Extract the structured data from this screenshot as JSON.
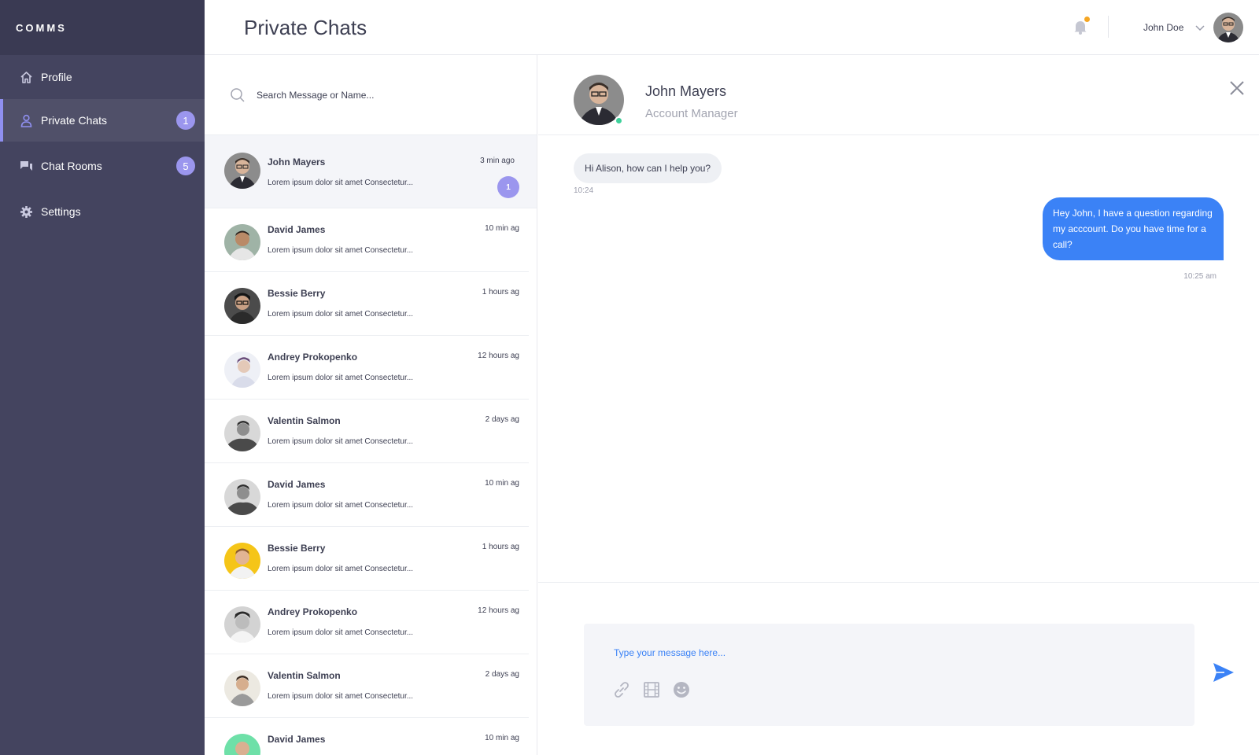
{
  "brand": {
    "name": "COMMS"
  },
  "nav": [
    {
      "label": "Profile",
      "icon": "home-icon",
      "badge": ""
    },
    {
      "label": "Private Chats",
      "icon": "user-icon",
      "badge": "1"
    },
    {
      "label": "Chat Rooms",
      "icon": "chat-rooms-icon",
      "badge": "5"
    },
    {
      "label": "Settings",
      "icon": "gear-icon",
      "badge": ""
    }
  ],
  "header": {
    "title": "Private Chats",
    "user_name": "John Doe",
    "notification_dot_color": "#f5a623"
  },
  "search": {
    "placeholder": "Search Message or Name..."
  },
  "chats": [
    {
      "name": "John Mayers",
      "preview": "Lorem ipsum dolor sit amet Consectetur...",
      "time": "3 min ago",
      "unread": "1"
    },
    {
      "name": "David James",
      "preview": "Lorem ipsum dolor sit amet Consectetur...",
      "time": "10 min ag"
    },
    {
      "name": "Bessie Berry",
      "preview": "Lorem ipsum dolor sit amet Consectetur...",
      "time": "1 hours ag"
    },
    {
      "name": "Andrey Prokopenko",
      "preview": "Lorem ipsum dolor sit amet Consectetur...",
      "time": "12 hours ag"
    },
    {
      "name": "Valentin Salmon",
      "preview": "Lorem ipsum dolor sit amet Consectetur...",
      "time": "2 days ag"
    },
    {
      "name": "David James",
      "preview": "Lorem ipsum dolor sit amet Consectetur...",
      "time": "10 min ag"
    },
    {
      "name": "Bessie Berry",
      "preview": "Lorem ipsum dolor sit amet Consectetur...",
      "time": "1 hours ag"
    },
    {
      "name": "Andrey Prokopenko",
      "preview": "Lorem ipsum dolor sit amet Consectetur...",
      "time": "12 hours ag"
    },
    {
      "name": "Valentin Salmon",
      "preview": "Lorem ipsum dolor sit amet Consectetur...",
      "time": "2 days ag"
    },
    {
      "name": "David James",
      "preview": "",
      "time": "10 min ag"
    }
  ],
  "conversation": {
    "name": "John Mayers",
    "role": "Account Manager",
    "messages": [
      {
        "direction": "in",
        "text": "Hi Alison, how can I help you?",
        "time": "10:24"
      },
      {
        "direction": "out",
        "text": "Hey John, I have a question regarding my acccount. Do you have time for a call?",
        "time": "10:25 am"
      }
    ]
  },
  "composer": {
    "placeholder": "Type your message here..."
  },
  "colors": {
    "sidebar": "#44445f",
    "sidebar_header": "#3a3a53",
    "accent": "#9b96ee",
    "outgoing_bubble": "#3b82f6",
    "online": "#3ed19b"
  }
}
